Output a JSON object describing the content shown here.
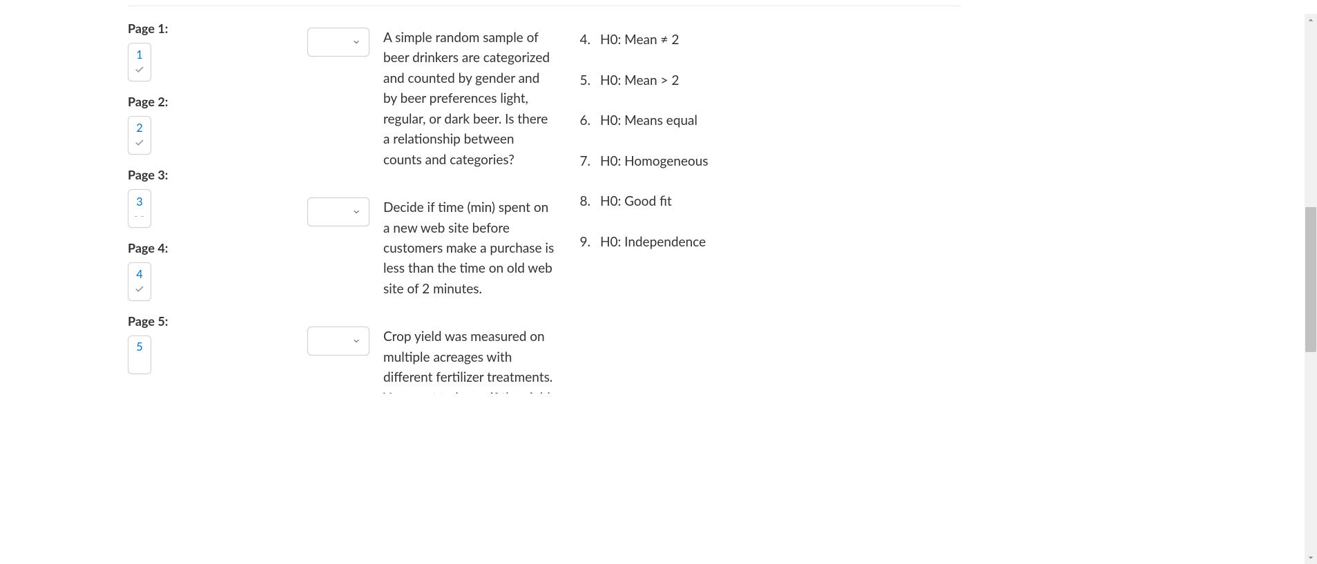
{
  "sidebar": {
    "pages": [
      {
        "label": "Page 1:",
        "num": "1",
        "status": "check"
      },
      {
        "label": "Page 2:",
        "num": "2",
        "status": "check"
      },
      {
        "label": "Page 3:",
        "num": "3",
        "status": "dash"
      },
      {
        "label": "Page 4:",
        "num": "4",
        "status": "check"
      },
      {
        "label": "Page 5:",
        "num": "5",
        "status": "none"
      }
    ]
  },
  "matching": {
    "prompts": [
      {
        "text": "A simple random sample of beer drinkers  are categorized and counted by gender and by beer preferences light, regular, or dark beer. Is there a relationship between counts and categories?"
      },
      {
        "text": "Decide if time (min) spent on a new web site before customers make a purchase is less than the time on old web site of 2 minutes."
      },
      {
        "text": "Crop yield was measured on multiple acreages with different fertilizer treatments. You want to know if the yields are equal."
      }
    ],
    "answers": [
      {
        "num": "4.",
        "text": "H0: Mean ≠ 2"
      },
      {
        "num": "5.",
        "text": "H0: Mean > 2"
      },
      {
        "num": "6.",
        "text": "H0: Means equal"
      },
      {
        "num": "7.",
        "text": "H0: Homogeneous"
      },
      {
        "num": "8.",
        "text": "H0: Good fit"
      },
      {
        "num": "9.",
        "text": "H0: Independence"
      }
    ]
  }
}
